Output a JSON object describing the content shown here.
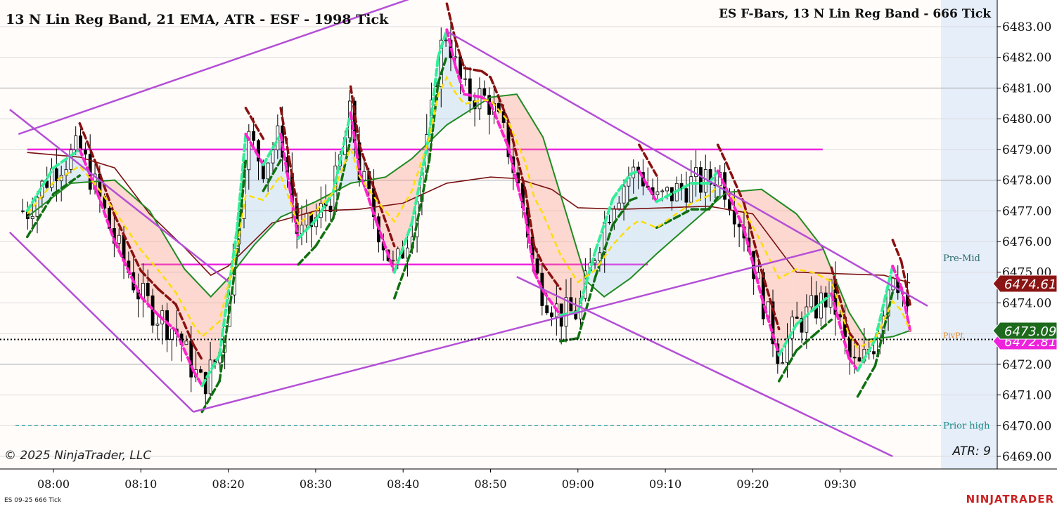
{
  "title_left": "13 N Lin Reg Band, 21 EMA, ATR - ESF - 1998 Tick",
  "title_right": "ES F-Bars, 13 N Lin Reg Band - 666 Tick",
  "copyright": "© 2025 NinjaTrader, LLC",
  "atr_label": "ATR: 9",
  "instrument_label": "ES 09-25 666 Tick",
  "brand": "NINJATRADER",
  "colors": {
    "background": "#fffcfa",
    "grid": "#c8c8c8",
    "up_candle": "#ffffff",
    "down_candle": "#000000",
    "channel": "#b44ed6",
    "level": "#ee22dd",
    "ema": "#208a20",
    "slow_ema": "#7a1010",
    "band_up": "#33ee99",
    "band_down": "#ff22cc",
    "band_yellow": "#ffdd00",
    "band_green": "#107010",
    "band_darkred": "#8a1010",
    "prior_high": "#229999",
    "price_red": "#8b1414",
    "price_green": "#1d6a1d",
    "price_magenta": "#ee22dd",
    "axis_shade": "#e6eefa",
    "brand": "#cc2222"
  },
  "chart_data": {
    "type": "candlestick",
    "title": "13 N Lin Reg Band, 21 EMA, ATR - ESF - 1998 Tick",
    "y_axis": {
      "min": 6469.0,
      "max": 6483.0,
      "ticks": [
        "6469.00",
        "6470.00",
        "6471.00",
        "6472.00",
        "6473.00",
        "6474.00",
        "6475.00",
        "6476.00",
        "6477.00",
        "6478.00",
        "6479.00",
        "6480.00",
        "6481.00",
        "6482.00",
        "6483.00"
      ]
    },
    "x_axis": {
      "start": "07:56",
      "end": "09:40",
      "ticks": [
        "08:00",
        "08:10",
        "08:20",
        "08:30",
        "08:40",
        "08:50",
        "09:00",
        "09:10",
        "09:20",
        "09:30"
      ]
    },
    "price_markers": [
      {
        "label": "6474.61",
        "value": 6474.61,
        "color": "price_red"
      },
      {
        "label": "6473.09",
        "value": 6473.09,
        "color": "price_green"
      },
      {
        "label": "6472.81",
        "value": 6472.81,
        "color": "price_magenta"
      }
    ],
    "level_labels": [
      {
        "text": "Pre-Mid",
        "value": 6475.45
      },
      {
        "text": "PivPt",
        "value": 6472.81
      },
      {
        "text": "Prior high",
        "value": 6470.0
      }
    ],
    "prior_high": 6470.0,
    "last_price": 6472.81,
    "horizontal_levels": [
      {
        "value": 6479.0,
        "from": "07:57",
        "to": "09:28"
      },
      {
        "value": 6475.25,
        "from": "08:10",
        "to": "09:08"
      }
    ],
    "channel_lines": [
      {
        "from": [
          "07:56",
          6479.5
        ],
        "to": [
          "08:58",
          6485.6
        ]
      },
      {
        "from": [
          "07:55",
          6480.3
        ],
        "to": [
          "08:20",
          6474.7
        ]
      },
      {
        "from": [
          "07:55",
          6476.3
        ],
        "to": [
          "08:16",
          6470.45
        ]
      },
      {
        "from": [
          "08:16",
          6470.45
        ],
        "to": [
          "09:28",
          6475.75
        ]
      },
      {
        "from": [
          "08:45",
          6482.85
        ],
        "to": [
          "09:40",
          6473.9
        ]
      },
      {
        "from": [
          "08:53",
          6474.85
        ],
        "to": [
          "09:36",
          6469.0
        ]
      }
    ],
    "ema": [
      [
        "07:57",
        6476.8
      ],
      [
        "08:02",
        6477.9
      ],
      [
        "08:07",
        6478.0
      ],
      [
        "08:11",
        6477.0
      ],
      [
        "08:15",
        6475.1
      ],
      [
        "08:18",
        6474.2
      ],
      [
        "08:20",
        6474.8
      ],
      [
        "08:23",
        6475.9
      ],
      [
        "08:26",
        6476.8
      ],
      [
        "08:30",
        6477.3
      ],
      [
        "08:34",
        6477.9
      ],
      [
        "08:38",
        6478.1
      ],
      [
        "08:41",
        6478.7
      ],
      [
        "08:45",
        6479.8
      ],
      [
        "08:50",
        6480.7
      ],
      [
        "08:53",
        6480.8
      ],
      [
        "08:56",
        6479.4
      ],
      [
        "08:59",
        6476.6
      ],
      [
        "09:01",
        6474.7
      ],
      [
        "09:03",
        6474.2
      ],
      [
        "09:06",
        6474.8
      ],
      [
        "09:09",
        6475.6
      ],
      [
        "09:13",
        6476.6
      ],
      [
        "09:17",
        6477.6
      ],
      [
        "09:21",
        6477.7
      ],
      [
        "09:25",
        6476.9
      ],
      [
        "09:28",
        6475.8
      ],
      [
        "09:31",
        6473.7
      ],
      [
        "09:33",
        6472.8
      ],
      [
        "09:36",
        6472.9
      ],
      [
        "09:38",
        6473.1
      ]
    ],
    "slow_ema": [
      [
        "07:57",
        6478.9
      ],
      [
        "08:03",
        6478.75
      ],
      [
        "08:07",
        6478.4
      ],
      [
        "08:11",
        6476.9
      ],
      [
        "08:15",
        6475.8
      ],
      [
        "08:18",
        6474.9
      ],
      [
        "08:20",
        6475.2
      ],
      [
        "08:25",
        6476.6
      ],
      [
        "08:30",
        6477.0
      ],
      [
        "08:35",
        6477.05
      ],
      [
        "08:40",
        6477.25
      ],
      [
        "08:45",
        6477.9
      ],
      [
        "08:50",
        6478.1
      ],
      [
        "08:53",
        6478.05
      ],
      [
        "08:57",
        6477.7
      ],
      [
        "09:00",
        6477.1
      ],
      [
        "09:05",
        6477.05
      ],
      [
        "09:10",
        6477.1
      ],
      [
        "09:15",
        6477.15
      ],
      [
        "09:20",
        6476.9
      ],
      [
        "09:25",
        6475.0
      ],
      [
        "09:30",
        6474.95
      ],
      [
        "09:35",
        6474.9
      ],
      [
        "09:38",
        6474.65
      ]
    ],
    "series": [
      {
        "name": "13 N Lin Reg Band",
        "style": "dashed",
        "points": [
          [
            "07:57",
            6477.0
          ],
          [
            "08:00",
            6478.4
          ],
          [
            "08:03",
            6479.0
          ],
          [
            "08:05",
            6477.6
          ],
          [
            "08:07",
            6476.0
          ],
          [
            "08:10",
            6474.2
          ],
          [
            "08:12",
            6473.6
          ],
          [
            "08:14",
            6473.1
          ],
          [
            "08:16",
            6471.8
          ],
          [
            "08:17",
            6471.3
          ],
          [
            "08:19",
            6472.3
          ],
          [
            "08:21",
            6476.4
          ],
          [
            "08:22",
            6479.5
          ],
          [
            "08:24",
            6478.5
          ],
          [
            "08:26",
            6479.5
          ],
          [
            "08:27",
            6477.8
          ],
          [
            "08:28",
            6476.1
          ],
          [
            "08:30",
            6476.7
          ],
          [
            "08:32",
            6477.6
          ],
          [
            "08:34",
            6480.2
          ],
          [
            "08:35",
            6478.3
          ],
          [
            "08:37",
            6476.6
          ],
          [
            "08:39",
            6475.0
          ],
          [
            "08:41",
            6476.6
          ],
          [
            "08:43",
            6479.5
          ],
          [
            "08:44",
            6482.0
          ],
          [
            "08:45",
            6482.9
          ],
          [
            "08:46",
            6481.7
          ],
          [
            "08:47",
            6480.8
          ],
          [
            "08:49",
            6480.7
          ],
          [
            "08:50",
            6480.5
          ],
          [
            "08:52",
            6479.1
          ],
          [
            "08:54",
            6476.8
          ],
          [
            "08:55",
            6475.0
          ],
          [
            "08:56",
            6474.4
          ],
          [
            "08:58",
            6473.6
          ],
          [
            "09:00",
            6473.7
          ],
          [
            "09:02",
            6475.7
          ],
          [
            "09:04",
            6477.4
          ],
          [
            "09:06",
            6478.2
          ],
          [
            "09:07",
            6478.3
          ],
          [
            "09:09",
            6477.3
          ],
          [
            "09:11",
            6477.6
          ],
          [
            "09:13",
            6477.9
          ],
          [
            "09:15",
            6477.9
          ],
          [
            "09:16",
            6478.3
          ],
          [
            "09:17",
            6477.7
          ],
          [
            "09:19",
            6476.4
          ],
          [
            "09:21",
            6474.2
          ],
          [
            "09:23",
            6472.3
          ],
          [
            "09:25",
            6473.3
          ],
          [
            "09:27",
            6473.8
          ],
          [
            "09:29",
            6474.3
          ],
          [
            "09:31",
            6472.2
          ],
          [
            "09:32",
            6471.8
          ],
          [
            "09:34",
            6472.8
          ],
          [
            "09:36",
            6475.2
          ],
          [
            "09:37",
            6474.5
          ],
          [
            "09:38",
            6473.1
          ]
        ]
      }
    ]
  }
}
